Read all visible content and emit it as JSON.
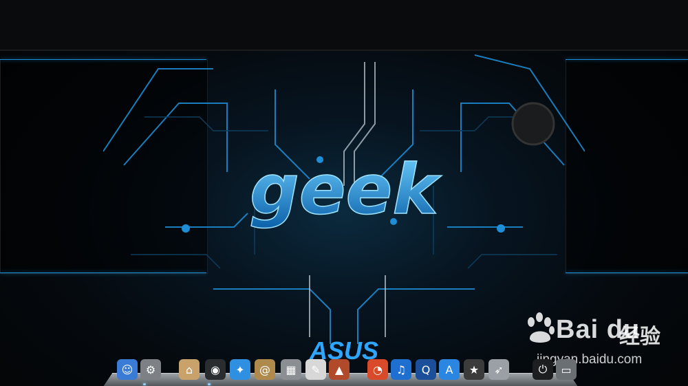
{
  "wallpaper": {
    "headline": "geek",
    "brand": "ASUS"
  },
  "watermark": {
    "brand": "Bai du",
    "chinese": "经验",
    "url": "jingyan.baidu.com"
  },
  "dock": {
    "items": [
      {
        "name": "finder-icon",
        "glyph": "☺",
        "bg": "#3a7bd5"
      },
      {
        "name": "system-preferences-icon",
        "glyph": "⚙",
        "bg": "#7d8185"
      },
      {
        "name": "home-folder-icon",
        "glyph": "⌂",
        "bg": "#c8a26a"
      },
      {
        "name": "dashboard-icon",
        "glyph": "◉",
        "bg": "#2a2d30"
      },
      {
        "name": "safari-icon",
        "glyph": "✦",
        "bg": "#2f8fe0"
      },
      {
        "name": "address-book-icon",
        "glyph": "@",
        "bg": "#b08a4c"
      },
      {
        "name": "calculator-icon",
        "glyph": "▦",
        "bg": "#8b8f93"
      },
      {
        "name": "textedit-icon",
        "glyph": "✎",
        "bg": "#d8d8d8"
      },
      {
        "name": "photo-app-icon",
        "glyph": "▲",
        "bg": "#b04a2a"
      },
      {
        "name": "chrome-icon",
        "glyph": "◔",
        "bg": "#d84a2a"
      },
      {
        "name": "itunes-icon",
        "glyph": "♫",
        "bg": "#1e6fd0"
      },
      {
        "name": "quicktime-icon",
        "glyph": "Q",
        "bg": "#1b4f9a"
      },
      {
        "name": "app-store-icon",
        "glyph": "A",
        "bg": "#2a86e0"
      },
      {
        "name": "imovie-icon",
        "glyph": "★",
        "bg": "#3b3b3b"
      },
      {
        "name": "launchpad-icon",
        "glyph": "➶",
        "bg": "#9aa0a5"
      },
      {
        "name": "power-icon",
        "glyph": "⏻",
        "bg": "#1c1e20"
      },
      {
        "name": "drive-icon",
        "glyph": "▭",
        "bg": "#6a6f74"
      }
    ]
  },
  "colors": {
    "accent": "#1e8fd6",
    "background": "#050607"
  }
}
